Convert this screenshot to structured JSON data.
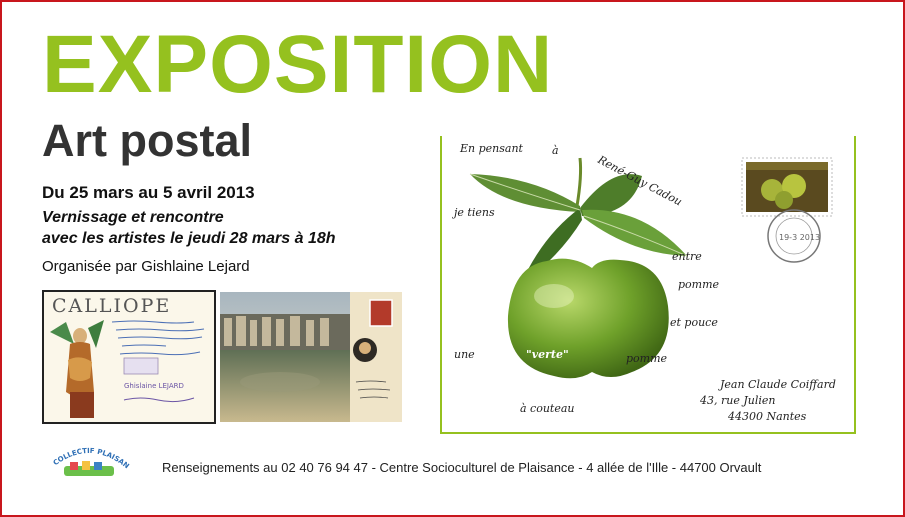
{
  "poster": {
    "headline": "EXPOSITION",
    "subheadline": "Art postal",
    "dates": "Du 25 mars au 5 avril 2013",
    "vernissage_line1": "Vernissage et rencontre",
    "vernissage_line2": "avec les artistes le jeudi 28 mars à 18h",
    "organizer": "Organisée par Gishlaine Lejard",
    "footer": "Renseignements au 02 40 76 94 47 - Centre Socioculturel de Plaisance - 4 allée de l'Ille - 44700 Orvault"
  },
  "thumbnail_1": {
    "title": "CALLIOPE",
    "signature": "Ghislaine LEJARD"
  },
  "mail_art": {
    "poem": [
      "En pensant",
      "à",
      "René-Guy Cadou",
      "je tiens",
      "entre",
      "pomme",
      "et pouce",
      "une",
      "\"verte\"",
      "pomme",
      "à couteau"
    ],
    "address": [
      "Jean Claude Coiffard",
      "43, rue Julien",
      "44300  Nantes"
    ],
    "postmark_date": "19-3 2013"
  },
  "logo": {
    "text": "COLLECTIF PLAISANCE"
  },
  "colors": {
    "accent_green": "#95c11f",
    "frame_red": "#c8161d",
    "dark_text": "#333333",
    "apple_green": "#6fa12a"
  }
}
